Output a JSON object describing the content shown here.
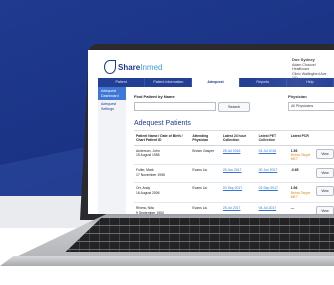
{
  "app": {
    "logo_main": "Share",
    "logo_sub": "Inmed",
    "user_name": "Doe Sydney",
    "user_line2": "Adam Chauvel Healthcare",
    "user_line3": "Clinic Wallingford Ave 101"
  },
  "nav": {
    "tabs": [
      "Patient",
      "Patient Information",
      "Adequest",
      "Reports",
      "Help"
    ],
    "active_index": 2
  },
  "sidebar": {
    "items": [
      {
        "label": "Adequest Dashboard",
        "active": true
      },
      {
        "label": "Adequest Settings",
        "active": false
      }
    ]
  },
  "search": {
    "label": "Find Patient by Name",
    "button": "Search"
  },
  "physician": {
    "label": "Physician",
    "selected": "All Physicians"
  },
  "section_title": "Adequest Patients",
  "table": {
    "headers": [
      "Patient Name / Date of Birth / Chart Patient ID",
      "Attending Physician",
      "Latest 24 hour Collection",
      "Latest PET Collection",
      "Latest PCR",
      ""
    ],
    "rows": [
      {
        "name": "Anderson, John",
        "dob": "15 August 1958",
        "physician": "Brown Gasper",
        "c24": "25 Jul 2016",
        "pet": "04 Jul 2016",
        "pcr": "1.56",
        "pcr_note": "Below Target MET",
        "action": "View"
      },
      {
        "name": "Fuller, Mark",
        "dob": "17 November 1955",
        "physician": "Evans Liu",
        "c24": "25 Jun 2017",
        "pet": "30 Jun 2017",
        "pcr": "-0.65",
        "pcr_note": "",
        "action": "View"
      },
      {
        "name": "Orr, Andy",
        "dob": "16 August 2006",
        "physician": "Evans Liu",
        "c24": "03 Sep 2017",
        "pet": "03 Sep 2017",
        "pcr": "1.56",
        "pcr_note": "Below Target MET",
        "action": "View"
      },
      {
        "name": "Rivera, Nita",
        "dob": "9 September 1950",
        "physician": "Evans Liu",
        "c24": "25 Jul 2017",
        "pet": "04 Jul 2017",
        "pcr": "—",
        "pcr_note": "",
        "action": "View"
      }
    ]
  }
}
